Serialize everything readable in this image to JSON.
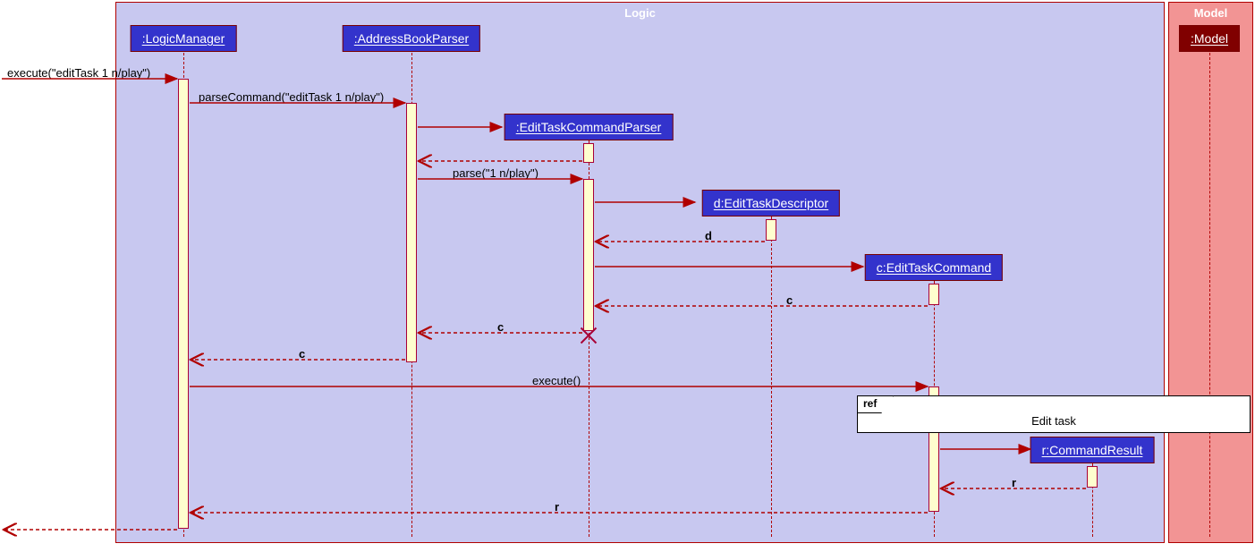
{
  "diagram": {
    "type": "sequence",
    "frames": {
      "logic": {
        "title": "Logic"
      },
      "model": {
        "title": "Model"
      }
    },
    "participants": {
      "logicManager": {
        "label": ":LogicManager"
      },
      "addressBookParser": {
        "label": ":AddressBookParser"
      },
      "editTaskCmdParser": {
        "label": ":EditTaskCommandParser"
      },
      "editTaskDescriptor": {
        "label": "d:EditTaskDescriptor"
      },
      "editTaskCommand": {
        "label": "c:EditTaskCommand"
      },
      "commandResult": {
        "label": "r:CommandResult"
      },
      "model": {
        "label": ":Model"
      }
    },
    "messages": {
      "execute_in": {
        "text": "execute(\"editTask 1 n/play\")"
      },
      "parseCommand": {
        "text": "parseCommand(\"editTask 1 n/play\")"
      },
      "parse": {
        "text": "parse(\"1 n/play\")"
      },
      "ret_d": {
        "text": "d"
      },
      "ret_c": {
        "text": "c"
      },
      "ret_c2": {
        "text": "c"
      },
      "ret_c3": {
        "text": "c"
      },
      "execute2": {
        "text": "execute()"
      },
      "ret_r": {
        "text": "r"
      },
      "ret_r2": {
        "text": "r"
      },
      "ret_final": {
        "text": ""
      }
    },
    "ref": {
      "tag": "ref",
      "label": "Edit task"
    }
  }
}
